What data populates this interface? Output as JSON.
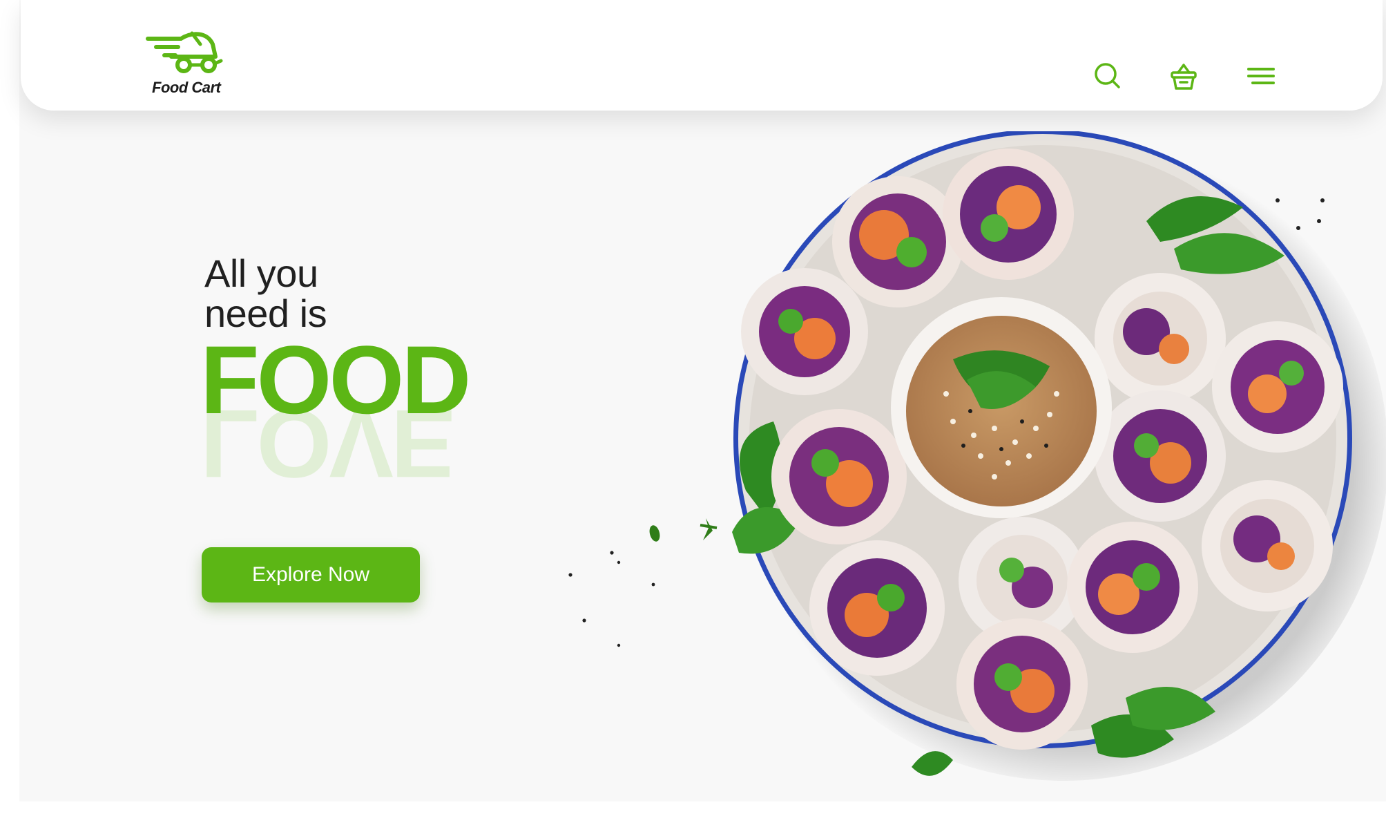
{
  "brand": {
    "name": "Food Cart",
    "accent_color": "#5cb615",
    "accent_light": "#e1efd6",
    "text_color": "#202020"
  },
  "header": {
    "icons": [
      "search-icon",
      "basket-icon",
      "menu-icon"
    ]
  },
  "hero": {
    "line1": "All you",
    "line2": "need is",
    "highlight": "FOOD",
    "reflection": "LOVE",
    "cta_label": "Explore Now"
  },
  "image": {
    "subject": "plate-of-spring-rolls-with-peanut-sauce"
  }
}
